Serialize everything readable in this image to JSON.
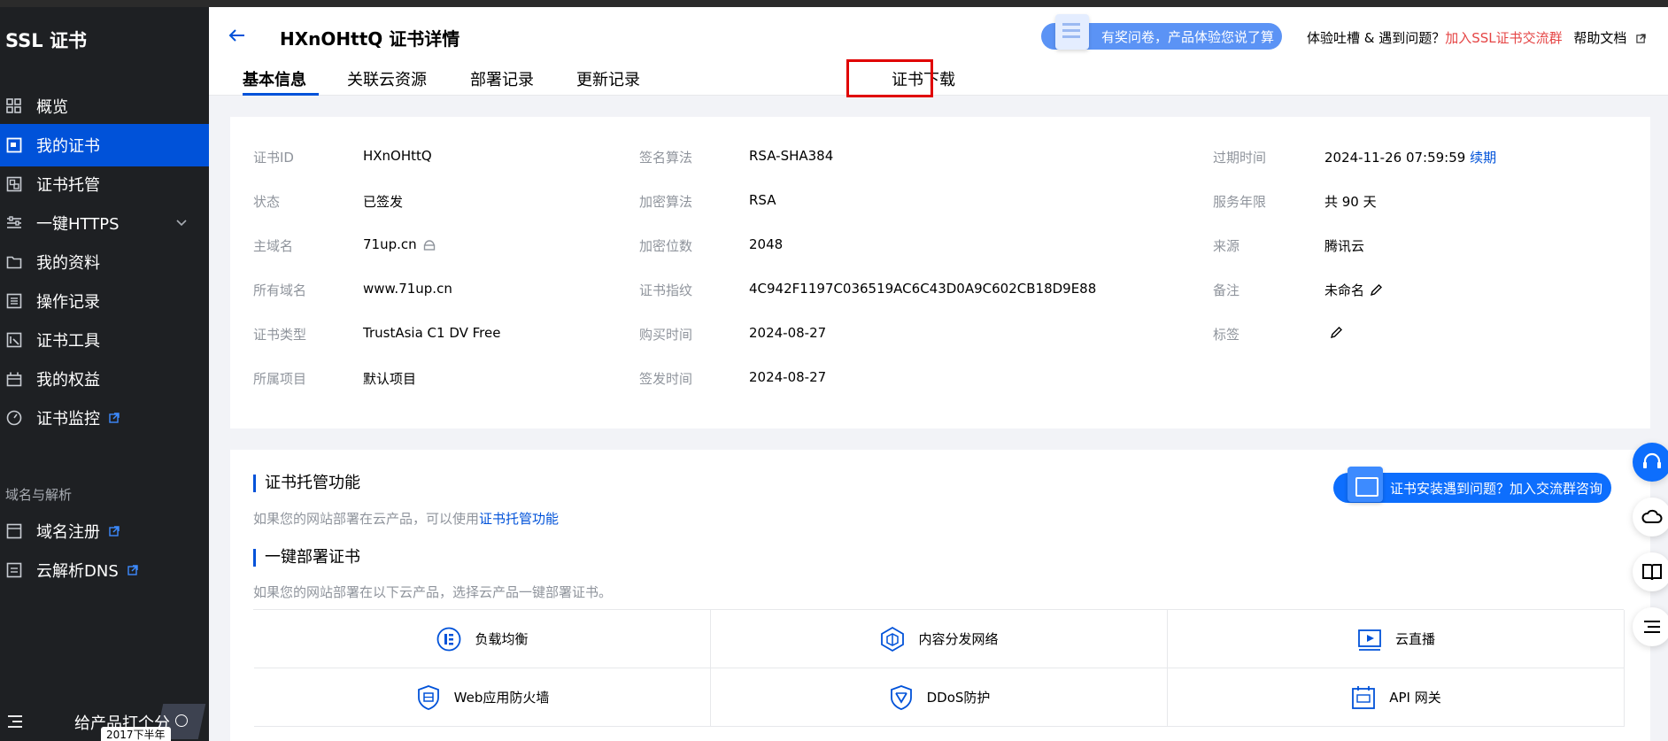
{
  "sidebar": {
    "title": "SSL 证书",
    "items": [
      {
        "label": "概览",
        "icon": "grid-icon"
      },
      {
        "label": "我的证书",
        "icon": "certificate-icon"
      },
      {
        "label": "证书托管",
        "icon": "hosting-icon"
      },
      {
        "label": "一键HTTPS",
        "icon": "sliders-icon"
      },
      {
        "label": "我的资料",
        "icon": "folder-icon"
      },
      {
        "label": "操作记录",
        "icon": "log-icon"
      },
      {
        "label": "证书工具",
        "icon": "tool-icon"
      },
      {
        "label": "我的权益",
        "icon": "gift-icon"
      },
      {
        "label": "证书监控",
        "icon": "monitor-icon"
      }
    ],
    "section_label": "域名与解析",
    "section_items": [
      {
        "label": "域名注册",
        "icon": "domain-icon"
      },
      {
        "label": "云解析DNS",
        "icon": "dns-icon"
      }
    ],
    "rate_label": "给产品打个分",
    "rate_badge": "2017下半年"
  },
  "header": {
    "title": "HXnOHttQ 证书详情",
    "survey": "有奖问卷，产品体验您说了算",
    "feedback_text": "体验吐槽 & 遇到问题？",
    "feedback_link": "加入SSL证书交流群",
    "help_label": "帮助文档",
    "tabs": [
      "基本信息",
      "关联云资源",
      "部署记录",
      "更新记录",
      "证书下载"
    ]
  },
  "details": {
    "col1": [
      {
        "label": "证书ID",
        "value": "HXnOHttQ"
      },
      {
        "label": "状态",
        "value": "已签发"
      },
      {
        "label": "主域名",
        "value": "71up.cn"
      },
      {
        "label": "所有域名",
        "value": "www.71up.cn"
      },
      {
        "label": "证书类型",
        "value": "TrustAsia C1 DV Free"
      },
      {
        "label": "所属项目",
        "value": "默认项目"
      }
    ],
    "col2": [
      {
        "label": "签名算法",
        "value": "RSA-SHA384"
      },
      {
        "label": "加密算法",
        "value": "RSA"
      },
      {
        "label": "加密位数",
        "value": "2048"
      },
      {
        "label": "证书指纹",
        "value": "4C942F1197C036519AC6C43D0A9C602CB18D9E88"
      },
      {
        "label": "购买时间",
        "value": "2024-08-27"
      },
      {
        "label": "签发时间",
        "value": "2024-08-27"
      }
    ],
    "col3": [
      {
        "label": "过期时间",
        "value": "2024-11-26 07:59:59",
        "link": "续期"
      },
      {
        "label": "服务年限",
        "value": "共 90 天"
      },
      {
        "label": "来源",
        "value": "腾讯云"
      },
      {
        "label": "备注",
        "value": "未命名"
      },
      {
        "label": "标签",
        "value": ""
      }
    ]
  },
  "hosting": {
    "title": "证书托管功能",
    "desc": "如果您的网站部署在云产品，可以使用",
    "desc_link": "证书托管功能",
    "join_button": "证书安装遇到问题？加入交流群咨询"
  },
  "deploy": {
    "title": "一键部署证书",
    "desc": "如果您的网站部署在以下云产品，选择云产品一键部署证书。",
    "products": [
      {
        "label": "负载均衡",
        "icon": "load-balancer-icon"
      },
      {
        "label": "内容分发网络",
        "icon": "cdn-icon"
      },
      {
        "label": "云直播",
        "icon": "live-stream-icon"
      },
      {
        "label": "Web应用防火墙",
        "icon": "waf-icon"
      },
      {
        "label": "DDoS防护",
        "icon": "ddos-icon"
      },
      {
        "label": "API 网关",
        "icon": "api-gateway-icon"
      }
    ]
  },
  "colors": {
    "accent": "#0052d9",
    "sidebar_bg": "#1e2023",
    "highlight": "#e00000",
    "link_red": "#e54545"
  }
}
